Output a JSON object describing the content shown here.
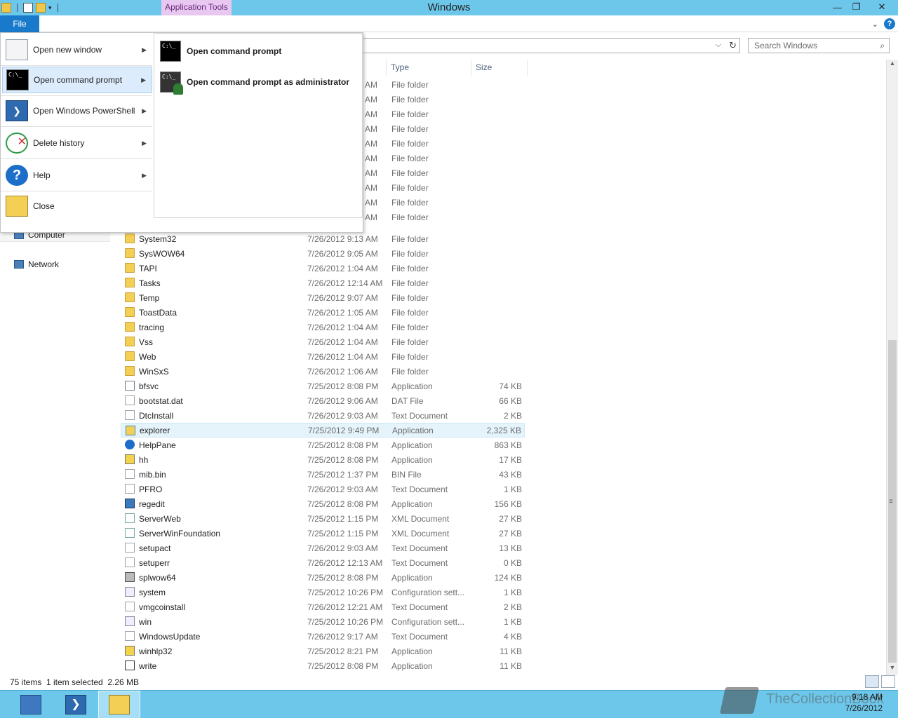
{
  "window": {
    "title": "Windows",
    "app_tools_label": "Application Tools",
    "min": "—",
    "restore": "❐",
    "close": "✕"
  },
  "ribbon": {
    "file_tab": "File",
    "help": "?"
  },
  "address": {
    "dropdown": "⌵",
    "refresh": "↻"
  },
  "search": {
    "placeholder": "Search Windows",
    "icon": "search-icon"
  },
  "columns": {
    "type": "Type",
    "size": "Size"
  },
  "nav": {
    "computer": "Computer",
    "network": "Network"
  },
  "file_menu": {
    "items": [
      {
        "label": "Open new window",
        "icon": "window-icon",
        "has_submenu": true
      },
      {
        "label": "Open command prompt",
        "icon": "command-prompt-icon",
        "has_submenu": true,
        "active": true
      },
      {
        "label": "Open Windows PowerShell",
        "icon": "powershell-icon",
        "has_submenu": true
      },
      {
        "label": "Delete history",
        "icon": "delete-history-icon",
        "has_submenu": true
      },
      {
        "label": "Help",
        "icon": "help-icon",
        "has_submenu": true
      },
      {
        "label": "Close",
        "icon": "close-window-icon",
        "has_submenu": false
      }
    ],
    "submenu": [
      {
        "label": "Open command prompt",
        "icon": "command-prompt-icon"
      },
      {
        "label": "Open command prompt as administrator",
        "icon": "admin-command-prompt-icon"
      }
    ],
    "cmd_glyph": "C:\\_",
    "ps_glyph": "❯"
  },
  "partial_rows": [
    {
      "time_suffix": "AM",
      "type": "File folder"
    },
    {
      "time_suffix": "AM",
      "type": "File folder"
    },
    {
      "time_suffix": "AM",
      "type": "File folder"
    },
    {
      "time_suffix": "AM",
      "type": "File folder"
    },
    {
      "time_suffix": "AM",
      "type": "File folder"
    },
    {
      "time_suffix": "AM",
      "type": "File folder"
    },
    {
      "time_suffix": "AM",
      "type": "File folder"
    },
    {
      "time_suffix": "AM",
      "type": "File folder"
    },
    {
      "time_suffix": "AM",
      "type": "File folder"
    },
    {
      "time_suffix": "AM",
      "type": "File folder"
    }
  ],
  "files": [
    {
      "name": "System32",
      "date": "7/26/2012 9:13 AM",
      "type": "File folder",
      "size": "",
      "icon": "folder"
    },
    {
      "name": "SysWOW64",
      "date": "7/26/2012 9:05 AM",
      "type": "File folder",
      "size": "",
      "icon": "folder"
    },
    {
      "name": "TAPI",
      "date": "7/26/2012 1:04 AM",
      "type": "File folder",
      "size": "",
      "icon": "folder"
    },
    {
      "name": "Tasks",
      "date": "7/26/2012 12:14 AM",
      "type": "File folder",
      "size": "",
      "icon": "folder"
    },
    {
      "name": "Temp",
      "date": "7/26/2012 9:07 AM",
      "type": "File folder",
      "size": "",
      "icon": "folder"
    },
    {
      "name": "ToastData",
      "date": "7/26/2012 1:05 AM",
      "type": "File folder",
      "size": "",
      "icon": "folder"
    },
    {
      "name": "tracing",
      "date": "7/26/2012 1:04 AM",
      "type": "File folder",
      "size": "",
      "icon": "folder"
    },
    {
      "name": "Vss",
      "date": "7/26/2012 1:04 AM",
      "type": "File folder",
      "size": "",
      "icon": "folder"
    },
    {
      "name": "Web",
      "date": "7/26/2012 1:04 AM",
      "type": "File folder",
      "size": "",
      "icon": "folder"
    },
    {
      "name": "WinSxS",
      "date": "7/26/2012 1:06 AM",
      "type": "File folder",
      "size": "",
      "icon": "folder"
    },
    {
      "name": "bfsvc",
      "date": "7/25/2012 8:08 PM",
      "type": "Application",
      "size": "74 KB",
      "icon": "app"
    },
    {
      "name": "bootstat.dat",
      "date": "7/26/2012 9:06 AM",
      "type": "DAT File",
      "size": "66 KB",
      "icon": "doc"
    },
    {
      "name": "DtcInstall",
      "date": "7/26/2012 9:03 AM",
      "type": "Text Document",
      "size": "2 KB",
      "icon": "doc"
    },
    {
      "name": "explorer",
      "date": "7/25/2012 9:49 PM",
      "type": "Application",
      "size": "2,325 KB",
      "icon": "explorer",
      "selected": true
    },
    {
      "name": "HelpPane",
      "date": "7/25/2012 8:08 PM",
      "type": "Application",
      "size": "863 KB",
      "icon": "help"
    },
    {
      "name": "hh",
      "date": "7/25/2012 8:08 PM",
      "type": "Application",
      "size": "17 KB",
      "icon": "qhelp"
    },
    {
      "name": "mib.bin",
      "date": "7/25/2012 1:37 PM",
      "type": "BIN File",
      "size": "43 KB",
      "icon": "doc"
    },
    {
      "name": "PFRO",
      "date": "7/26/2012 9:03 AM",
      "type": "Text Document",
      "size": "1 KB",
      "icon": "doc"
    },
    {
      "name": "regedit",
      "date": "7/25/2012 8:08 PM",
      "type": "Application",
      "size": "156 KB",
      "icon": "reg"
    },
    {
      "name": "ServerWeb",
      "date": "7/25/2012 1:15 PM",
      "type": "XML Document",
      "size": "27 KB",
      "icon": "xml"
    },
    {
      "name": "ServerWinFoundation",
      "date": "7/25/2012 1:15 PM",
      "type": "XML Document",
      "size": "27 KB",
      "icon": "xml"
    },
    {
      "name": "setupact",
      "date": "7/26/2012 9:03 AM",
      "type": "Text Document",
      "size": "13 KB",
      "icon": "doc"
    },
    {
      "name": "setuperr",
      "date": "7/26/2012 12:13 AM",
      "type": "Text Document",
      "size": "0 KB",
      "icon": "doc"
    },
    {
      "name": "splwow64",
      "date": "7/25/2012 8:08 PM",
      "type": "Application",
      "size": "124 KB",
      "icon": "print"
    },
    {
      "name": "system",
      "date": "7/25/2012 10:26 PM",
      "type": "Configuration sett...",
      "size": "1 KB",
      "icon": "cfg"
    },
    {
      "name": "vmgcoinstall",
      "date": "7/26/2012 12:21 AM",
      "type": "Text Document",
      "size": "2 KB",
      "icon": "doc"
    },
    {
      "name": "win",
      "date": "7/25/2012 10:26 PM",
      "type": "Configuration sett...",
      "size": "1 KB",
      "icon": "cfg"
    },
    {
      "name": "WindowsUpdate",
      "date": "7/26/2012 9:17 AM",
      "type": "Text Document",
      "size": "4 KB",
      "icon": "doc"
    },
    {
      "name": "winhlp32",
      "date": "7/25/2012 8:21 PM",
      "type": "Application",
      "size": "11 KB",
      "icon": "qhelp"
    },
    {
      "name": "write",
      "date": "7/25/2012 8:08 PM",
      "type": "Application",
      "size": "11 KB",
      "icon": "write"
    }
  ],
  "status": {
    "item_count": "75 items",
    "selection": "1 item selected  2.26 MB"
  },
  "taskbar": {
    "time": "9:18 AM",
    "date": "7/26/2012",
    "watermark": "TheCollectionBook"
  },
  "colors": {
    "title_bar": "#6dc7ea",
    "file_tab": "#1979ca",
    "selection": "#e5f3fb"
  }
}
